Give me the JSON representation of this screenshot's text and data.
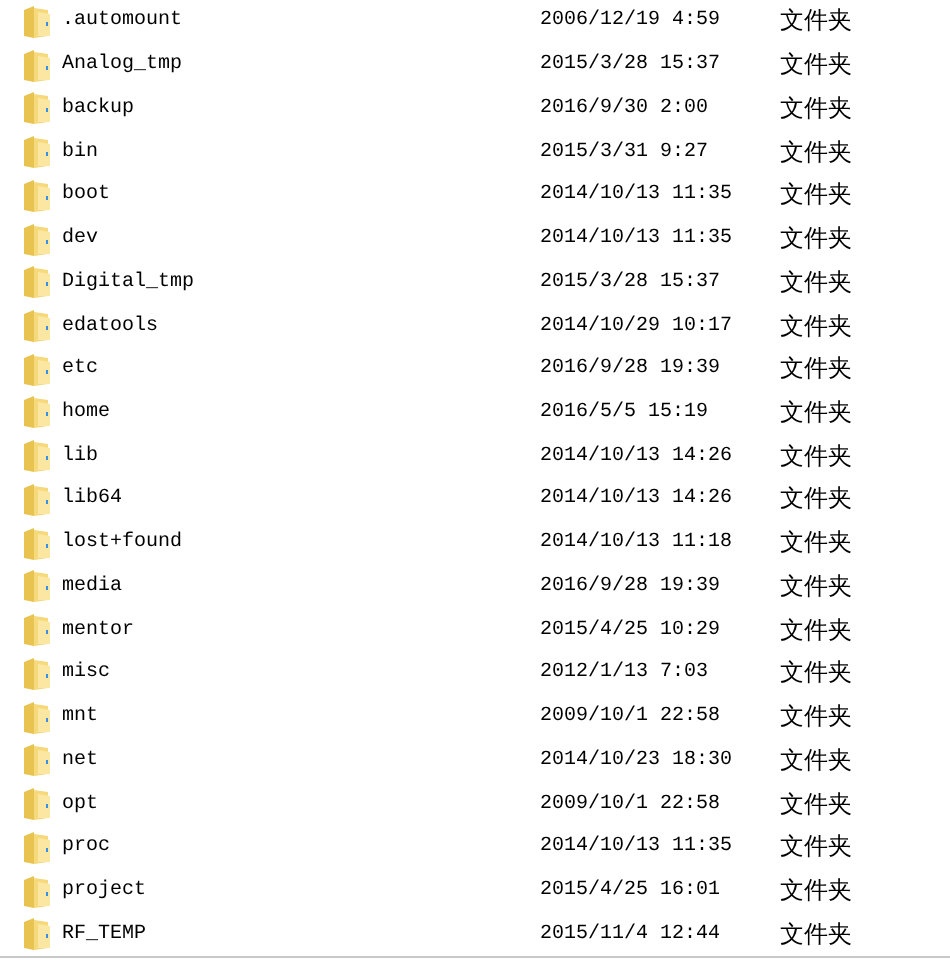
{
  "files": [
    {
      "name": ".automount",
      "modified": "2006/12/19 4:59",
      "type": "文件夹"
    },
    {
      "name": "Analog_tmp",
      "modified": "2015/3/28 15:37",
      "type": "文件夹"
    },
    {
      "name": "backup",
      "modified": "2016/9/30 2:00",
      "type": "文件夹"
    },
    {
      "name": "bin",
      "modified": "2015/3/31 9:27",
      "type": "文件夹"
    },
    {
      "name": "boot",
      "modified": "2014/10/13 11:35",
      "type": "文件夹"
    },
    {
      "name": "dev",
      "modified": "2014/10/13 11:35",
      "type": "文件夹"
    },
    {
      "name": "Digital_tmp",
      "modified": "2015/3/28 15:37",
      "type": "文件夹"
    },
    {
      "name": "edatools",
      "modified": "2014/10/29 10:17",
      "type": "文件夹"
    },
    {
      "name": "etc",
      "modified": "2016/9/28 19:39",
      "type": "文件夹"
    },
    {
      "name": "home",
      "modified": "2016/5/5 15:19",
      "type": "文件夹"
    },
    {
      "name": "lib",
      "modified": "2014/10/13 14:26",
      "type": "文件夹"
    },
    {
      "name": "lib64",
      "modified": "2014/10/13 14:26",
      "type": "文件夹"
    },
    {
      "name": "lost+found",
      "modified": "2014/10/13 11:18",
      "type": "文件夹"
    },
    {
      "name": "media",
      "modified": "2016/9/28 19:39",
      "type": "文件夹"
    },
    {
      "name": "mentor",
      "modified": "2015/4/25 10:29",
      "type": "文件夹"
    },
    {
      "name": "misc",
      "modified": "2012/1/13 7:03",
      "type": "文件夹"
    },
    {
      "name": "mnt",
      "modified": "2009/10/1 22:58",
      "type": "文件夹"
    },
    {
      "name": "net",
      "modified": "2014/10/23 18:30",
      "type": "文件夹"
    },
    {
      "name": "opt",
      "modified": "2009/10/1 22:58",
      "type": "文件夹"
    },
    {
      "name": "proc",
      "modified": "2014/10/13 11:35",
      "type": "文件夹"
    },
    {
      "name": "project",
      "modified": "2015/4/25 16:01",
      "type": "文件夹"
    },
    {
      "name": "RF_TEMP",
      "modified": "2015/11/4 12:44",
      "type": "文件夹"
    }
  ]
}
